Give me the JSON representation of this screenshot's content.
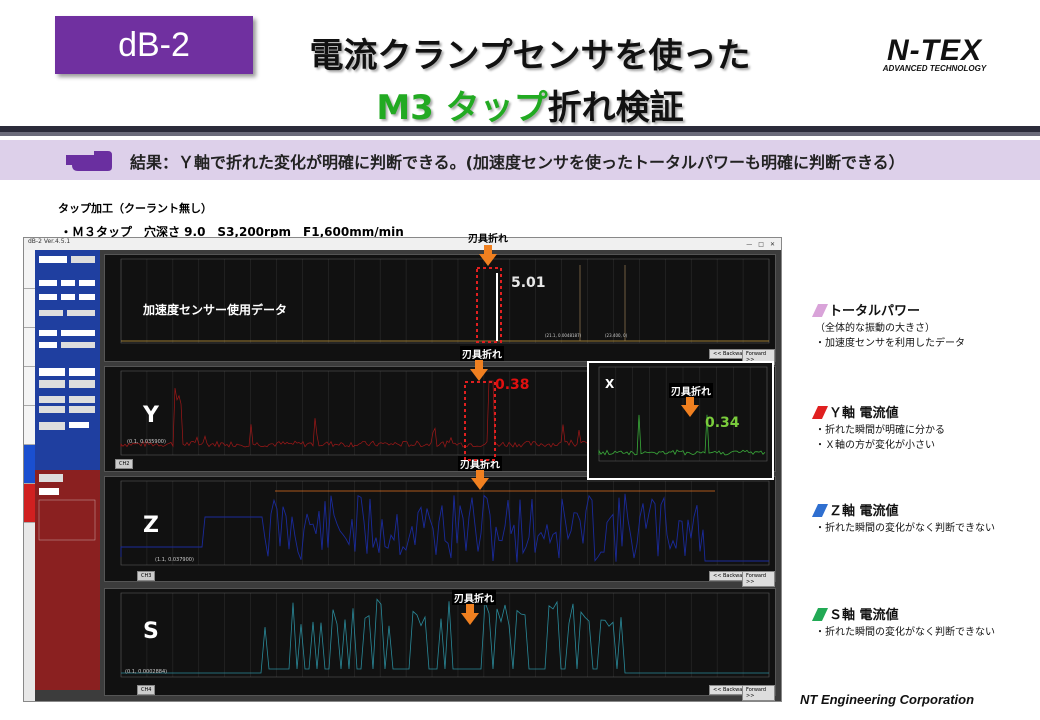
{
  "header": {
    "badge": "dB-2",
    "title_line1": "電流クランプセンサを使った",
    "title_line2_highlight": "M3 タップ",
    "title_line2_rest": "折れ検証",
    "logo_main": "N-TEX",
    "logo_sub": "ADVANCED TECHNOLOGY"
  },
  "result": {
    "text": "結果：Ｙ軸で折れた変化が明確に判断できる。(加速度センサを使ったトータルパワーも明確に判断できる）"
  },
  "conditions": {
    "line1": "タップ加工（クーラント無し）",
    "line2": "・Ｍ３タップ　穴深さ 9.0　S3,200rpm　F1,600mm/min"
  },
  "window": {
    "title": "dB-2 Ver.4.5.1",
    "sidebar_tabs": [
      "ログ",
      "Sensor",
      "Position",
      "Setting",
      "Filter",
      "Alarm",
      "Proximity",
      "Thread"
    ]
  },
  "panels": {
    "accel": {
      "label": "加速度センサー使用データ",
      "value": "5.01",
      "broken": "刃具折れ",
      "readout1": "(21.1, 0.0048187)",
      "readout2": "(23.400, 0)"
    },
    "y": {
      "label": "Y",
      "value": "0.38",
      "broken": "刃具折れ",
      "readout": "(0.1, 0.035900)",
      "inset_label": "X",
      "inset_broken": "刃具折れ",
      "inset_value": "0.34",
      "select": "CH2"
    },
    "z": {
      "label": "Z",
      "broken": "刃具折れ",
      "readout": "(1.1, 0.037900)",
      "select": "CH3"
    },
    "s": {
      "label": "S",
      "broken": "刃具折れ",
      "readout": "(0.1, 0.0002884)",
      "select": "CH4"
    },
    "backward": "<< Backward",
    "forward": "Forward >>"
  },
  "legend": [
    {
      "head": "トータルパワー",
      "lines": [
        "（全体的な振動の大きさ）",
        "・加速度センサを利用したデータ"
      ],
      "color": "#d9a3d9"
    },
    {
      "head": "Ｙ軸 電流値",
      "lines": [
        "・折れた瞬間が明確に分かる",
        "・Ｘ軸の方が変化が小さい"
      ],
      "color": "#e02020"
    },
    {
      "head": "Ｚ軸 電流値",
      "lines": [
        "・折れた瞬間の変化がなく判断できない"
      ],
      "color": "#2f6fd0"
    },
    {
      "head": "Ｓ軸 電流値",
      "lines": [
        "・折れた瞬間の変化がなく判断できない"
      ],
      "color": "#22aa55"
    }
  ],
  "footer": "NT Engineering Corporation"
}
